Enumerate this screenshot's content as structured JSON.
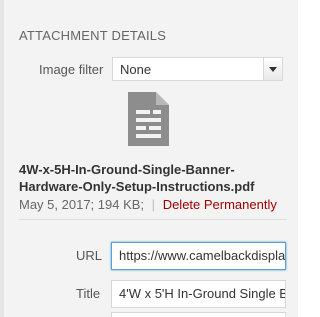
{
  "section": {
    "title": "ATTACHMENT DETAILS"
  },
  "image_filter": {
    "label": "Image filter",
    "selected_value": "None"
  },
  "attachment": {
    "icon": "document-icon",
    "file_name": "4W-x-5H-In-Ground-Single-Banner-Hardware-Only-Setup-Instructions.pdf",
    "date": "May 5, 2017;",
    "size": "194 KB;",
    "delete_link": "Delete Permanently"
  },
  "fields": {
    "url": {
      "label": "URL",
      "value": "https://www.camelbackdispla"
    },
    "title": {
      "label": "Title",
      "value": "4'W x 5'H In-Ground Single Ba"
    }
  },
  "colors": {
    "panel_background": "#f3f3f3",
    "delete_link": "#a00000",
    "focus_border": "#5b9dd9",
    "icon": "#888888"
  }
}
